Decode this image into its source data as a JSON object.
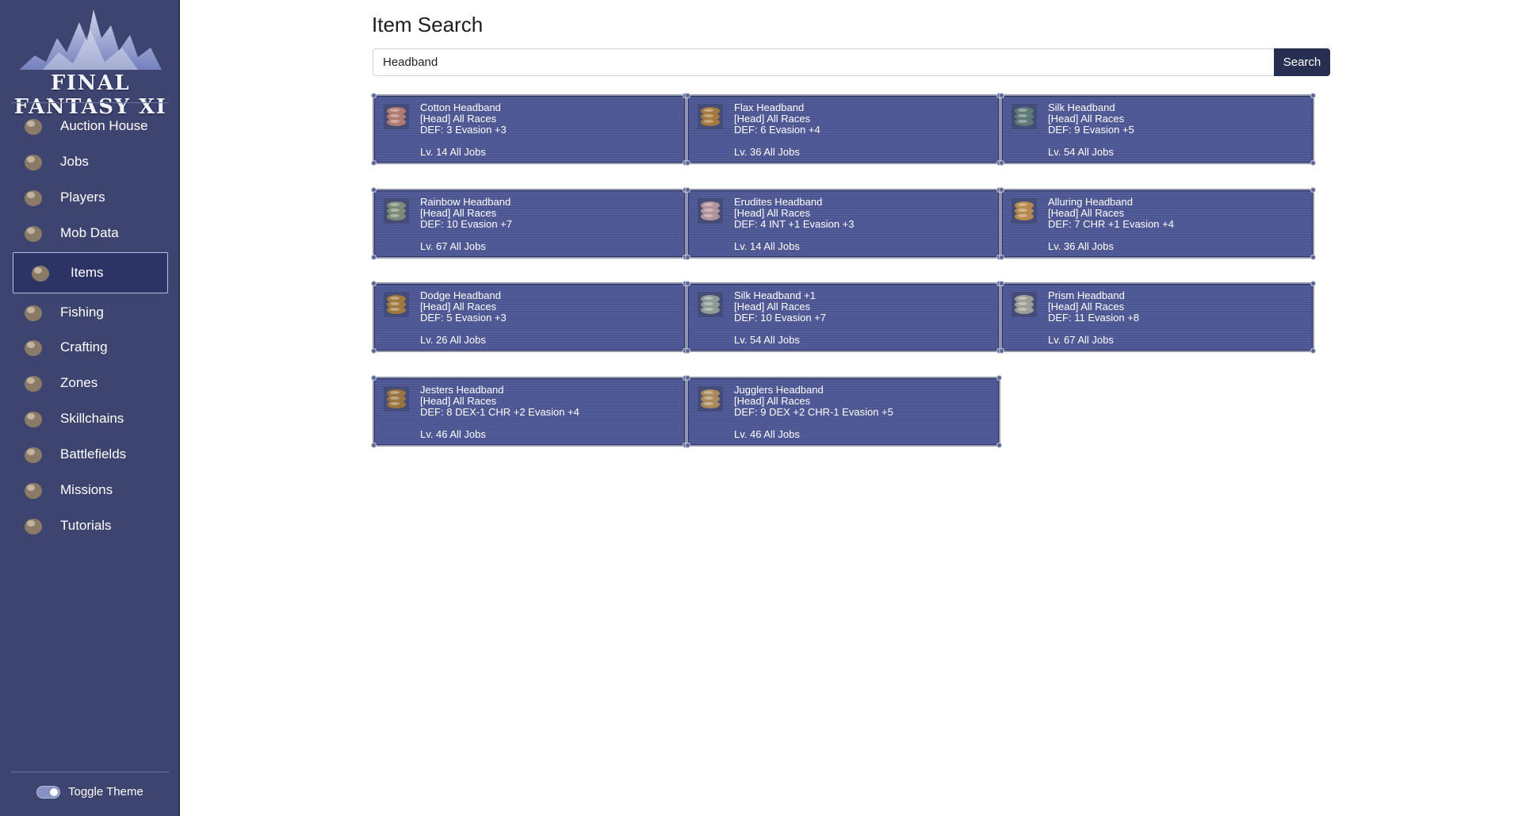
{
  "app": {
    "logo_text": "FINAL FANTASY XI",
    "toggle_label": "Toggle Theme"
  },
  "sidebar": {
    "items": [
      {
        "label": "Auction House",
        "icon": "auction-house-icon",
        "active": false
      },
      {
        "label": "Jobs",
        "icon": "jobs-icon",
        "active": false
      },
      {
        "label": "Players",
        "icon": "players-icon",
        "active": false
      },
      {
        "label": "Mob Data",
        "icon": "mob-data-icon",
        "active": false
      },
      {
        "label": "Items",
        "icon": "items-icon",
        "active": true
      },
      {
        "label": "Fishing",
        "icon": "fishing-icon",
        "active": false
      },
      {
        "label": "Crafting",
        "icon": "crafting-icon",
        "active": false
      },
      {
        "label": "Zones",
        "icon": "zones-icon",
        "active": false
      },
      {
        "label": "Skillchains",
        "icon": "skillchains-icon",
        "active": false
      },
      {
        "label": "Battlefields",
        "icon": "battlefields-icon",
        "active": false
      },
      {
        "label": "Missions",
        "icon": "missions-icon",
        "active": false
      },
      {
        "label": "Tutorials",
        "icon": "tutorials-icon",
        "active": false
      }
    ]
  },
  "main": {
    "title": "Item Search",
    "search": {
      "value": "Headband",
      "button_label": "Search"
    },
    "results": [
      {
        "name": "Cotton Headband",
        "slot": "[Head] All Races",
        "stats": "DEF: 3  Evasion +3",
        "level": "Lv. 14 All Jobs",
        "tint": "#b07a72"
      },
      {
        "name": "Flax Headband",
        "slot": "[Head] All Races",
        "stats": "DEF: 6  Evasion +4",
        "level": "Lv. 36 All Jobs",
        "tint": "#a67a3c"
      },
      {
        "name": "Silk Headband",
        "slot": "[Head] All Races",
        "stats": "DEF: 9  Evasion +5",
        "level": "Lv. 54 All Jobs",
        "tint": "#5f7a76"
      },
      {
        "name": "Rainbow Headband",
        "slot": "[Head] All Races",
        "stats": "DEF: 10  Evasion +7",
        "level": "Lv. 67 All Jobs",
        "tint": "#7c8a78"
      },
      {
        "name": "Erudites Headband",
        "slot": "[Head] All Races",
        "stats": "DEF: 4  INT +1  Evasion +3",
        "level": "Lv. 14 All Jobs",
        "tint": "#b3939a"
      },
      {
        "name": "Alluring Headband",
        "slot": "[Head] All Races",
        "stats": "DEF: 7  CHR +1  Evasion +4",
        "level": "Lv. 36 All Jobs",
        "tint": "#b58a4e"
      },
      {
        "name": "Dodge Headband",
        "slot": "[Head] All Races",
        "stats": "DEF: 5  Evasion +3",
        "level": "Lv. 26 All Jobs",
        "tint": "#a07a3c"
      },
      {
        "name": "Silk Headband +1",
        "slot": "[Head] All Races",
        "stats": "DEF: 10  Evasion +7",
        "level": "Lv. 54 All Jobs",
        "tint": "#8e9a94"
      },
      {
        "name": "Prism Headband",
        "slot": "[Head] All Races",
        "stats": "DEF: 11  Evasion +8",
        "level": "Lv. 67 All Jobs",
        "tint": "#9aa096"
      },
      {
        "name": "Jesters Headband",
        "slot": "[Head] All Races",
        "stats": "DEF: 8  DEX-1  CHR +2  Evasion +4",
        "level": "Lv. 46 All Jobs",
        "tint": "#9a7440"
      },
      {
        "name": "Jugglers Headband",
        "slot": "[Head] All Races",
        "stats": "DEF: 9  DEX +2  CHR-1  Evasion +5",
        "level": "Lv. 46 All Jobs",
        "tint": "#a98a5a"
      }
    ]
  }
}
